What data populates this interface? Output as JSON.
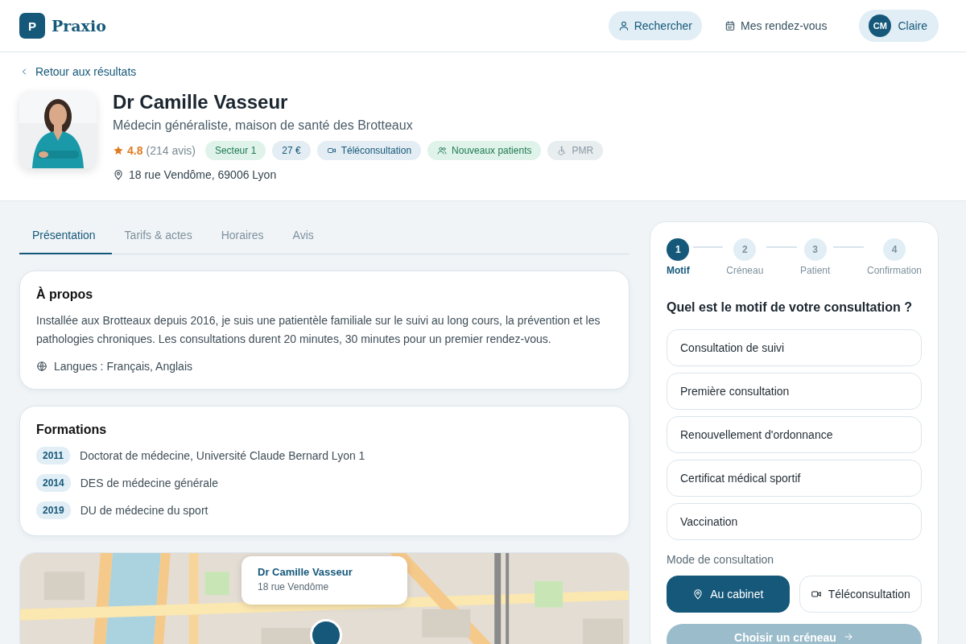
{
  "header": {
    "logo_letter": "P",
    "brand": "Praxio",
    "nav": [
      {
        "label": "Rechercher",
        "selected": true
      },
      {
        "label": "Mes rendez-vous",
        "selected": false
      }
    ],
    "user": {
      "initials": "CM",
      "name": "Claire"
    }
  },
  "back_link": "Retour aux résultats",
  "doctor": {
    "name": "Dr Camille Vasseur",
    "specialty": "Médecin généraliste, maison de santé des Brotteaux",
    "rating": "4.8",
    "reviews": "(214 avis)",
    "tags": [
      {
        "label": "Secteur 1",
        "kind": "sector"
      },
      {
        "label": "27 €",
        "kind": "price"
      },
      {
        "label": "Téléconsultation",
        "kind": "video"
      },
      {
        "label": "Nouveaux patients",
        "kind": "newpatients"
      },
      {
        "label": "PMR",
        "kind": "access"
      }
    ],
    "address": "18 rue Vendôme, 69006 Lyon"
  },
  "tabs": [
    {
      "label": "Présentation",
      "selected": true
    },
    {
      "label": "Tarifs & actes",
      "selected": false
    },
    {
      "label": "Horaires",
      "selected": false
    },
    {
      "label": "Avis",
      "selected": false
    }
  ],
  "about": {
    "title": "À propos",
    "text": "Installée aux Brotteaux depuis 2016, je suis une patientèle familiale sur le suivi au long cours, la prévention et les pathologies chroniques. Les consultations durent 20 minutes, 30 minutes pour un premier rendez-vous.",
    "languages": "Langues : Français, Anglais"
  },
  "formations": {
    "title": "Formations",
    "items": [
      {
        "year": "2011",
        "label": "Doctorat de médecine, Université Claude Bernard Lyon 1"
      },
      {
        "year": "2014",
        "label": "DES de médecine générale"
      },
      {
        "year": "2019",
        "label": "DU de médecine du sport"
      }
    ]
  },
  "map": {
    "popup": {
      "name": "Dr Camille Vasseur",
      "address": "18 rue Vendôme"
    }
  },
  "booking": {
    "steps": [
      {
        "number": "1",
        "label": "Motif",
        "selected": true
      },
      {
        "number": "2",
        "label": "Créneau",
        "selected": false
      },
      {
        "number": "3",
        "label": "Patient",
        "selected": false
      },
      {
        "number": "4",
        "label": "Confirmation",
        "selected": false
      }
    ],
    "question": "Quel est le motif de votre consultation ?",
    "reasons": [
      {
        "label": "Consultation de suivi",
        "selected": false
      },
      {
        "label": "Première consultation",
        "selected": false
      },
      {
        "label": "Renouvellement d'ordonnance",
        "selected": false
      },
      {
        "label": "Certificat médical sportif",
        "selected": false
      },
      {
        "label": "Vaccination",
        "selected": false
      }
    ],
    "mode_label": "Mode de consultation",
    "modes": [
      {
        "label": "Au cabinet",
        "selected": true
      },
      {
        "label": "Téléconsultation",
        "selected": false
      }
    ],
    "submit": {
      "label": "Choisir un créneau",
      "disabled": true
    }
  }
}
